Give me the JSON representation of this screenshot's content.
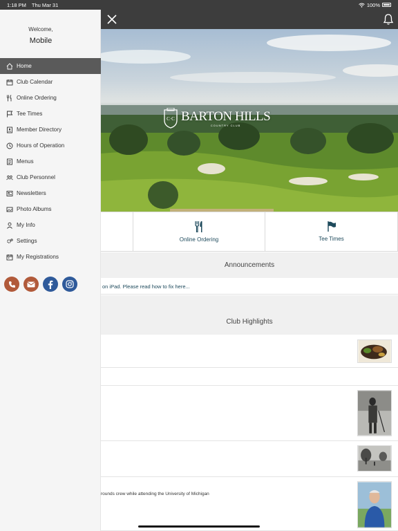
{
  "status_bar": {
    "time": "1:18 PM",
    "date": "Thu Mar 31",
    "battery": "100%"
  },
  "sidebar": {
    "welcome_line": "Welcome,",
    "user_name": "Mobile",
    "items": [
      {
        "label": "Home",
        "icon": "home-icon",
        "active": true
      },
      {
        "label": "Club Calendar",
        "icon": "calendar-icon"
      },
      {
        "label": "Online Ordering",
        "icon": "utensils-icon"
      },
      {
        "label": "Tee Times",
        "icon": "flag-icon"
      },
      {
        "label": "Member Directory",
        "icon": "address-book-icon"
      },
      {
        "label": "Hours of Operation",
        "icon": "clock-icon"
      },
      {
        "label": "Menus",
        "icon": "menu-book-icon"
      },
      {
        "label": "Club Personnel",
        "icon": "users-icon"
      },
      {
        "label": "Newsletters",
        "icon": "newspaper-icon"
      },
      {
        "label": "Photo Albums",
        "icon": "photo-icon"
      },
      {
        "label": "My Info",
        "icon": "user-icon"
      },
      {
        "label": "Settings",
        "icon": "gears-icon"
      },
      {
        "label": "My Registrations",
        "icon": "calendar-check-icon"
      }
    ],
    "social": [
      {
        "name": "phone-icon",
        "color": "#b15a3a"
      },
      {
        "name": "envelope-icon",
        "color": "#b15a3a"
      },
      {
        "name": "facebook-icon",
        "color": "#2f5a9a"
      },
      {
        "name": "instagram-icon",
        "color": "#2f5a9a"
      }
    ]
  },
  "hero": {
    "logo_text": "BARTON HILLS",
    "logo_sub": "COUNTRY CLUB",
    "logo_shield": "C·C"
  },
  "quick_links": [
    {
      "label": "",
      "icon": ""
    },
    {
      "label": "Online Ordering",
      "icon": "utensils-icon"
    },
    {
      "label": "Tee Times",
      "icon": "flag-icon"
    }
  ],
  "announcements": {
    "heading": "Announcements",
    "item": "on iPad. Please read how to fix here..."
  },
  "highlights": {
    "heading": "Club Highlights",
    "items": [
      {
        "text": "",
        "thumb": "food-photo"
      },
      {
        "text": "",
        "thumb": ""
      },
      {
        "text": "",
        "thumb": "golfer-photo"
      },
      {
        "text": "",
        "thumb": "course-bw-photo"
      },
      {
        "text": "rounds crew while attending the University of Michigan",
        "thumb": "portrait-photo"
      }
    ]
  },
  "colors": {
    "accent": "#1e4a5c",
    "topbar": "#3d3d3d",
    "sidebar_active": "#5a5a5a"
  }
}
